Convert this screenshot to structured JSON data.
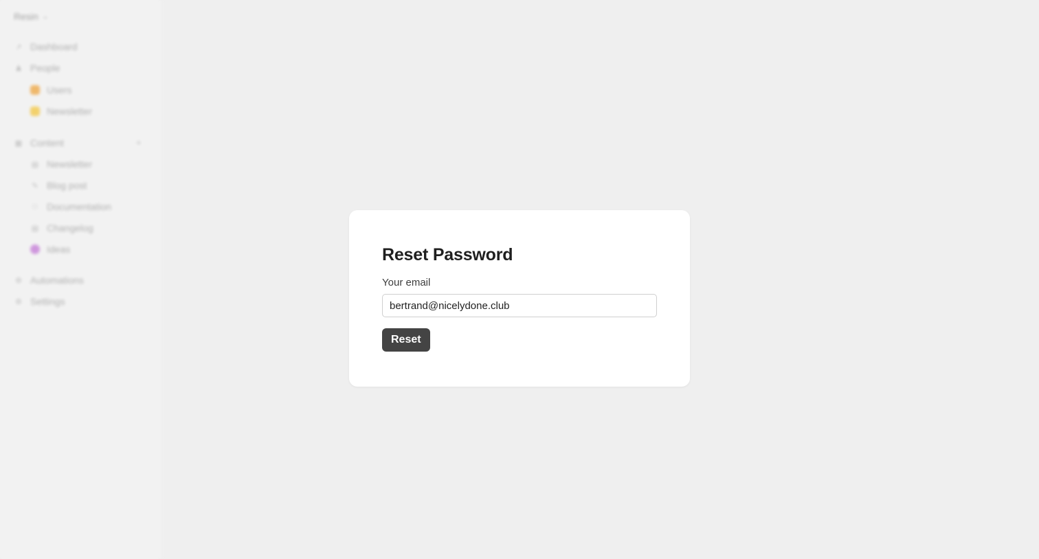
{
  "sidebar": {
    "workspace_name": "Resin",
    "items": [
      {
        "label": "Dashboard",
        "icon": "chart-icon"
      },
      {
        "label": "People",
        "icon": "person-icon"
      },
      {
        "label": "Users",
        "icon": "users-emoji-icon",
        "color": "#f0a640"
      },
      {
        "label": "Newsletter",
        "icon": "newsletter-emoji-icon",
        "color": "#f5c842"
      },
      {
        "label": "Content",
        "icon": "content-icon"
      },
      {
        "label": "Newsletter",
        "icon": "newspaper-icon"
      },
      {
        "label": "Blog post",
        "icon": "pen-icon"
      },
      {
        "label": "Documentation",
        "icon": "document-icon"
      },
      {
        "label": "Changelog",
        "icon": "list-icon"
      },
      {
        "label": "Ideas",
        "icon": "ideas-emoji-icon",
        "color": "#c57ad8"
      },
      {
        "label": "Automations",
        "icon": "automation-icon"
      },
      {
        "label": "Settings",
        "icon": "gear-icon"
      }
    ],
    "add_symbol": "+"
  },
  "dialog": {
    "title": "Reset Password",
    "email_label": "Your email",
    "email_value": "bertrand@nicelydone.club",
    "reset_label": "Reset"
  },
  "colors": {
    "background": "#efefef",
    "card": "#ffffff",
    "button": "#444444"
  }
}
